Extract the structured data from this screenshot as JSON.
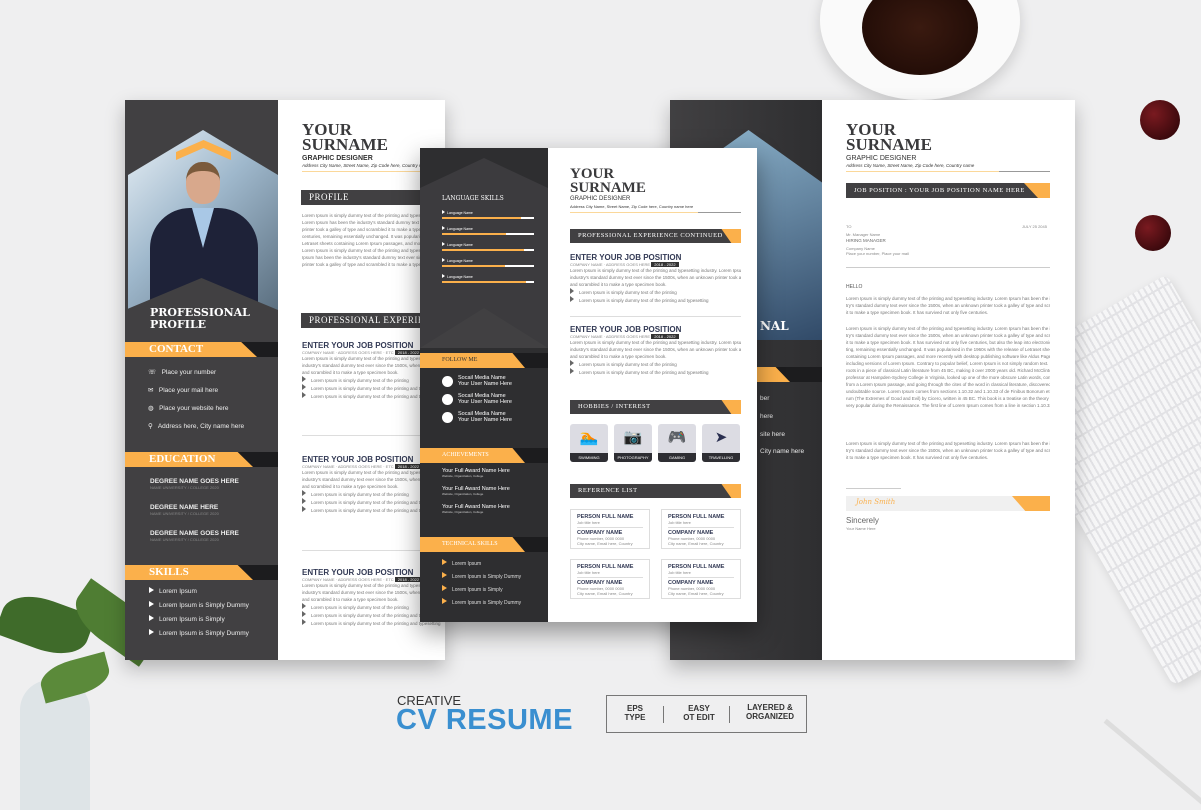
{
  "colors": {
    "accent": "#fbb04b",
    "dark": "#414042",
    "black": "#1c1c1e",
    "brand_blue": "#3a8fd0",
    "background": "#efeff0"
  },
  "resume_left": {
    "name_line1": "YOUR",
    "name_line2": "SURNAME",
    "title": "GRAPHIC DESIGNER",
    "address": "Address City Name, Street Name, Zip Code here, Country name",
    "sidebar_heading_1": "PROFESSIONAL",
    "sidebar_heading_2": "PROFILE",
    "contact_heading": "CONTACT",
    "contacts": [
      {
        "icon": "phone-icon",
        "text": "Place your number"
      },
      {
        "icon": "mail-icon",
        "text": "Place your mail here"
      },
      {
        "icon": "globe-icon",
        "text": "Place your website here"
      },
      {
        "icon": "location-icon",
        "text": "Address here, City name here"
      }
    ],
    "education_heading": "EDUCATION",
    "degrees": [
      "DEGREE NAME GOES HERE",
      "DEGREE NAME HERE",
      "DEGREE NAME GOES HERE"
    ],
    "degree_sub": "NAME UNIVERSITY / COLLEGE 2020",
    "skills_heading": "SKILLS",
    "skills": [
      "Lorem Ipsum",
      "Lorem Ipsum is Simply Dummy",
      "Lorem Ipsum is Simply",
      "Lorem Ipsum is Simply Dummy"
    ],
    "profile_heading": "PROFILE",
    "profile_text": [
      "Lorem Ipsum is simply dummy text of the printing and typesetting industry.",
      "Lorem Ipsum has been the industry's standard dummy text ever since the 1500s, when an unknown",
      "printer took a galley of type and scrambled it to make a type specimen book. It has survived not only five",
      "centuries, remaining essentially unchanged. It was popularised in the 1960s with the release of",
      "Letraset sheets containing Lorem Ipsum passages, and more recently with desktop publishing.",
      "Lorem Ipsum is simply dummy text of the printing and typesetting industry. Lorem",
      "Ipsum has been the industry's standard dummy text ever since the 1500s, when an unknown",
      "printer took a galley of type and scrambled it to make a type specimen book."
    ],
    "experience_heading": "PROFESSIONAL EXPERIENCE",
    "job_title": "ENTER YOUR JOB POSITION",
    "job_company": "COMPANY NAME · ADDRESS GOES HERE · ETC",
    "job_dates": "2018 - 2022",
    "job_text": [
      "Lorem Ipsum is simply dummy text of the printing and typesetting",
      "industry's standard dummy text ever since the 1500s, when an",
      "and scrambled it to make a type specimen book."
    ],
    "job_bullets": [
      "Lorem Ipsum is simply dummy text of the printing",
      "Lorem Ipsum is simply dummy text of the printing and typesetting",
      "Lorem Ipsum is simply dummy text of the printing and typesetting"
    ]
  },
  "resume_middle": {
    "name_line1": "YOUR",
    "name_line2": "SURNAME",
    "title": "GRAPHIC DESIGNER",
    "address": "Address City Name, Street Name, Zip Code here, Country name here",
    "language_heading": "LANGUAGE SKILLS",
    "languages": [
      {
        "label": "Language Name",
        "level": 0.86
      },
      {
        "label": "Language Name",
        "level": 0.7
      },
      {
        "label": "Language Name",
        "level": 0.89
      },
      {
        "label": "Language Name",
        "level": 0.68
      },
      {
        "label": "Language Name",
        "level": 0.91
      }
    ],
    "follow_heading": "FOLLOW ME",
    "social": [
      {
        "name": "Socail Media Name",
        "user": "Your User Name Here"
      },
      {
        "name": "Socail Media Name",
        "user": "Your User Name Here"
      },
      {
        "name": "Socail Media Name",
        "user": "Your User Name Here"
      }
    ],
    "achievements_heading": "ACHIEVEMENTS",
    "awards": [
      "Your Full Award Name Here",
      "Your Full Award Name Here",
      "Your Full Award Name Here"
    ],
    "award_sub": "Website, Organization, College",
    "technical_heading": "TECHNICAL SKILLS",
    "technical": [
      "Lorem Ipsum",
      "Lorem Ipsum is Simply Dummy",
      "Lorem Ipsum is Simply",
      "Lorem Ipsum is Simply Dummy"
    ],
    "experience_heading": "PROFESSIONAL EXPERIENCE CONTINUED",
    "job_title": "ENTER YOUR JOB POSITION",
    "job_company": "COMPANY NAME · ADDRESS GOES HERE",
    "job_dates": "2018 - 2022",
    "job_text": [
      "Lorem Ipsum is simply dummy text of the printing and typesetting industry. Lorem Ipsum has been the",
      "industry's standard dummy text ever since the 1500s, when an unknown printer took a galley of type",
      "and scrambled it to make a type specimen book."
    ],
    "job_bullets": [
      "Lorem Ipsum is simply dummy text of the printing",
      "Lorem Ipsum is simply dummy text of the printing and typesetting"
    ],
    "hobbies_heading": "HOBBIES / INTEREST",
    "hobbies": [
      {
        "icon": "swimming-icon",
        "label": "SWIMMING"
      },
      {
        "icon": "camera-icon",
        "label": "PHOTOGRAPHY"
      },
      {
        "icon": "gamepad-icon",
        "label": "GAMING"
      },
      {
        "icon": "plane-icon",
        "label": "TRAVELLING"
      }
    ],
    "reference_heading": "REFERENCE LIST",
    "reference": {
      "person": "PERSON FULL NAME",
      "role": "Job title here",
      "company": "COMPANY NAME",
      "phone": "Phone number, 0000 0000",
      "email": "City name, Email here, Country"
    }
  },
  "resume_right": {
    "name_line1": "YOUR",
    "name_line2": "SURNAME",
    "title": "GRAPHIC DESIGNER",
    "address": "Address City Name, Street Name, Zip Code here, Country name",
    "job_bar": "JOB POSITION : YOUR JOB POSITION NAME HERE",
    "to": "TO",
    "date": "JULY 25 2045",
    "mr": "Mr. Manager Name",
    "manager": "HIRING MANAGER",
    "company": "Company Name",
    "place": "Place your number, Place your mail",
    "hello": "HELLO",
    "para1": [
      "Lorem Ipsum is simply dummy text of the printing and typesetting industry. Lorem Ipsum has been the indus-",
      "try's standard dummy text ever since the 1500s, when an unknown printer took a galley of type and scrambled",
      "it to make a type specimen book. It has survived not only five centuries."
    ],
    "para2": [
      "Lorem Ipsum is simply dummy text of the printing and typesetting industry. Lorem Ipsum has been the indus-",
      "try's standard dummy text ever since the 1500s, when an unknown printer took a galley of type and scrambled",
      "it to make a type specimen book. It has survived not only five centuries, but also the leap into electronic typeset-",
      "ting, remaining essentially unchanged. It was popularised in the 1960s with the release of Letraset sheets",
      "containing Lorem Ipsum passages, and more recently with desktop publishing software like Aldus PageMaker",
      "including versions of Lorem Ipsum. Contrary to popular belief, Lorem Ipsum is not simply random text. It has",
      "roots in a piece of classical Latin literature from 45 BC, making it over 2000 years old. Richard McClintock, a Latin",
      "professor at Hampden-Sydney College in Virginia, looked up one of the more obscure Latin words, consectetur,",
      "from a Lorem Ipsum passage, and going through the cites of the word in classical literature, discovered the",
      "undoubtable source. Lorem Ipsum comes from sections 1.10.32 and 1.10.33 of de Finibus Bonorum et Malo-",
      "rum (The Extremes of Good and Evil) by Cicero, written in 45 BC. This book is a treatise on the theory of ethics,",
      "very popular during the Renaissance. The first line of Lorem Ipsum comes from a line in section 1.10.32."
    ],
    "para3": [
      "Lorem Ipsum is simply dummy text of the printing and typesetting industry. Lorem Ipsum has been the indus-",
      "try's standard dummy text ever since the 1500s, when an unknown printer took a galley of type and scrambled",
      "it to make a type specimen book. It has survived not only five centuries."
    ],
    "signature": "John Smith",
    "sincerely": "Sincerely",
    "sign_name": "Your Name Here",
    "side_fragment": "NAL",
    "side_items": [
      "ber",
      "here",
      "site here",
      "City name here"
    ]
  },
  "promo": {
    "kicker": "CREATIVE",
    "title": "CV RESUME",
    "features": [
      [
        "EPS",
        "TYPE"
      ],
      [
        "EASY",
        "OT EDIT"
      ],
      [
        "LAYERED &",
        "ORGANIZED"
      ]
    ]
  }
}
